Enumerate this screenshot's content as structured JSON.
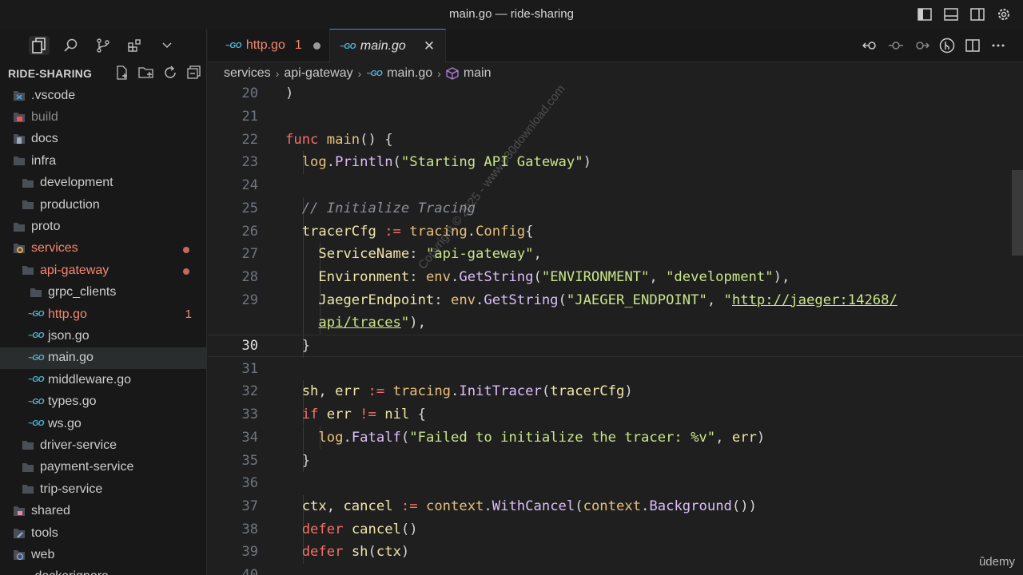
{
  "window": {
    "title": "main.go — ride-sharing"
  },
  "explorer": {
    "title": "RIDE-SHARING"
  },
  "tree": [
    {
      "label": ".vscode",
      "icon": "vscode-folder-icon",
      "indent": 0
    },
    {
      "label": "build",
      "icon": "build-folder-icon",
      "indent": 0,
      "dim": true
    },
    {
      "label": "docs",
      "icon": "docs-folder-icon",
      "indent": 0
    },
    {
      "label": "infra",
      "icon": "folder-icon",
      "indent": 0
    },
    {
      "label": "development",
      "icon": "folder-icon",
      "indent": 1
    },
    {
      "label": "production",
      "icon": "folder-icon",
      "indent": 1
    },
    {
      "label": "proto",
      "icon": "folder-icon",
      "indent": 0
    },
    {
      "label": "services",
      "icon": "services-folder-icon",
      "indent": 0,
      "err": true,
      "dot": true
    },
    {
      "label": "api-gateway",
      "icon": "folder-icon",
      "indent": 1,
      "err": true,
      "dot": true
    },
    {
      "label": "grpc_clients",
      "icon": "folder-icon",
      "indent": 2
    },
    {
      "label": "http.go",
      "icon": "go-file-icon",
      "indent": 2,
      "err": true,
      "count": "1"
    },
    {
      "label": "json.go",
      "icon": "go-file-icon",
      "indent": 2
    },
    {
      "label": "main.go",
      "icon": "go-file-icon",
      "indent": 2,
      "selected": true
    },
    {
      "label": "middleware.go",
      "icon": "go-file-icon",
      "indent": 2
    },
    {
      "label": "types.go",
      "icon": "go-file-icon",
      "indent": 2
    },
    {
      "label": "ws.go",
      "icon": "go-file-icon",
      "indent": 2
    },
    {
      "label": "driver-service",
      "icon": "folder-icon",
      "indent": 1
    },
    {
      "label": "payment-service",
      "icon": "folder-icon",
      "indent": 1
    },
    {
      "label": "trip-service",
      "icon": "folder-icon",
      "indent": 1
    },
    {
      "label": "shared",
      "icon": "shared-folder-icon",
      "indent": 0
    },
    {
      "label": "tools",
      "icon": "tools-folder-icon",
      "indent": 0
    },
    {
      "label": "web",
      "icon": "web-folder-icon",
      "indent": 0
    },
    {
      "label": ".dockerignore",
      "icon": "docker-icon",
      "indent": 0
    }
  ],
  "tabs": {
    "http": {
      "label": "http.go",
      "count": "1"
    },
    "main": {
      "label": "main.go",
      "close": "✕"
    }
  },
  "breadcrumb": {
    "items": [
      "services",
      "api-gateway",
      "main.go",
      "main"
    ],
    "separator": "›"
  },
  "code": {
    "current_line": "30",
    "lines": [
      {
        "n": "20",
        "html": "<span class=\"br\">)</span>"
      },
      {
        "n": "21",
        "html": ""
      },
      {
        "n": "22",
        "html": "<span class=\"k\">func</span> <span class=\"fn\">main</span><span class=\"br\">() {</span>"
      },
      {
        "n": "23",
        "html": "  <span class=\"pk\">log</span>.<span class=\"f\">Println</span><span class=\"br\">(</span><span class=\"s\">\"Starting API Gateway\"</span><span class=\"br\">)</span>"
      },
      {
        "n": "24",
        "html": ""
      },
      {
        "n": "25",
        "html": "  <span class=\"c\">// Initialize Tracing</span>"
      },
      {
        "n": "26",
        "html": "  <span class=\"id\">tracerCfg</span> <span class=\"k\">:=</span> <span class=\"pk\">tracing</span>.<span class=\"typ\">Config</span><span class=\"br\">{</span>"
      },
      {
        "n": "27",
        "html": "    <span class=\"id\">ServiceName</span>: <span class=\"s\">\"api-gateway\"</span>,"
      },
      {
        "n": "28",
        "html": "    <span class=\"id\">Environment</span>: <span class=\"pk\">env</span>.<span class=\"f\">GetString</span><span class=\"br\">(</span><span class=\"s\">\"ENVIRONMENT\"</span>, <span class=\"s\">\"development\"</span><span class=\"br\">)</span>,"
      },
      {
        "n": "29",
        "html": "    <span class=\"id\">JaegerEndpoint</span>: <span class=\"pk\">env</span>.<span class=\"f\">GetString</span><span class=\"br\">(</span><span class=\"s\">\"JAEGER_ENDPOINT\"</span>, <span class=\"s\">\"</span><span class=\"lnk\">http://jaeger:14268/</span>"
      },
      {
        "n": "",
        "html": "    <span class=\"lnk\">api/traces</span><span class=\"s\">\"</span><span class=\"br\">)</span>,"
      },
      {
        "n": "30",
        "html": "  <span class=\"br\">}</span>"
      },
      {
        "n": "31",
        "html": ""
      },
      {
        "n": "32",
        "html": "  <span class=\"id\">sh</span>, <span class=\"id\">err</span> <span class=\"k\">:=</span> <span class=\"pk\">tracing</span>.<span class=\"f\">InitTracer</span><span class=\"br\">(</span><span class=\"id\">tracerCfg</span><span class=\"br\">)</span>"
      },
      {
        "n": "33",
        "html": "  <span class=\"k\">if</span> <span class=\"id\">err</span> <span class=\"k\">!=</span> <span class=\"id\">nil</span> <span class=\"br\">{</span>"
      },
      {
        "n": "34",
        "html": "    <span class=\"pk\">log</span>.<span class=\"f\">Fatalf</span><span class=\"br\">(</span><span class=\"s\">\"Failed to initialize the tracer: %v\"</span>, <span class=\"id\">err</span><span class=\"br\">)</span>"
      },
      {
        "n": "35",
        "html": "  <span class=\"br\">}</span>"
      },
      {
        "n": "36",
        "html": ""
      },
      {
        "n": "37",
        "html": "  <span class=\"id\">ctx</span>, <span class=\"id\">cancel</span> <span class=\"k\">:=</span> <span class=\"pk\">context</span>.<span class=\"f\">WithCancel</span><span class=\"br\">(</span><span class=\"pk\">context</span>.<span class=\"f\">Background</span><span class=\"br\">())</span>"
      },
      {
        "n": "38",
        "html": "  <span class=\"k\">defer</span> <span class=\"id\">cancel</span><span class=\"br\">()</span>"
      },
      {
        "n": "39",
        "html": "  <span class=\"k\">defer</span> <span class=\"id\">sh</span><span class=\"br\">(</span><span class=\"id\">ctx</span><span class=\"br\">)</span>"
      },
      {
        "n": "40",
        "html": ""
      }
    ]
  },
  "watermark": "Copyright © 2025 - www.p30download.com",
  "brand": "ûdemy"
}
